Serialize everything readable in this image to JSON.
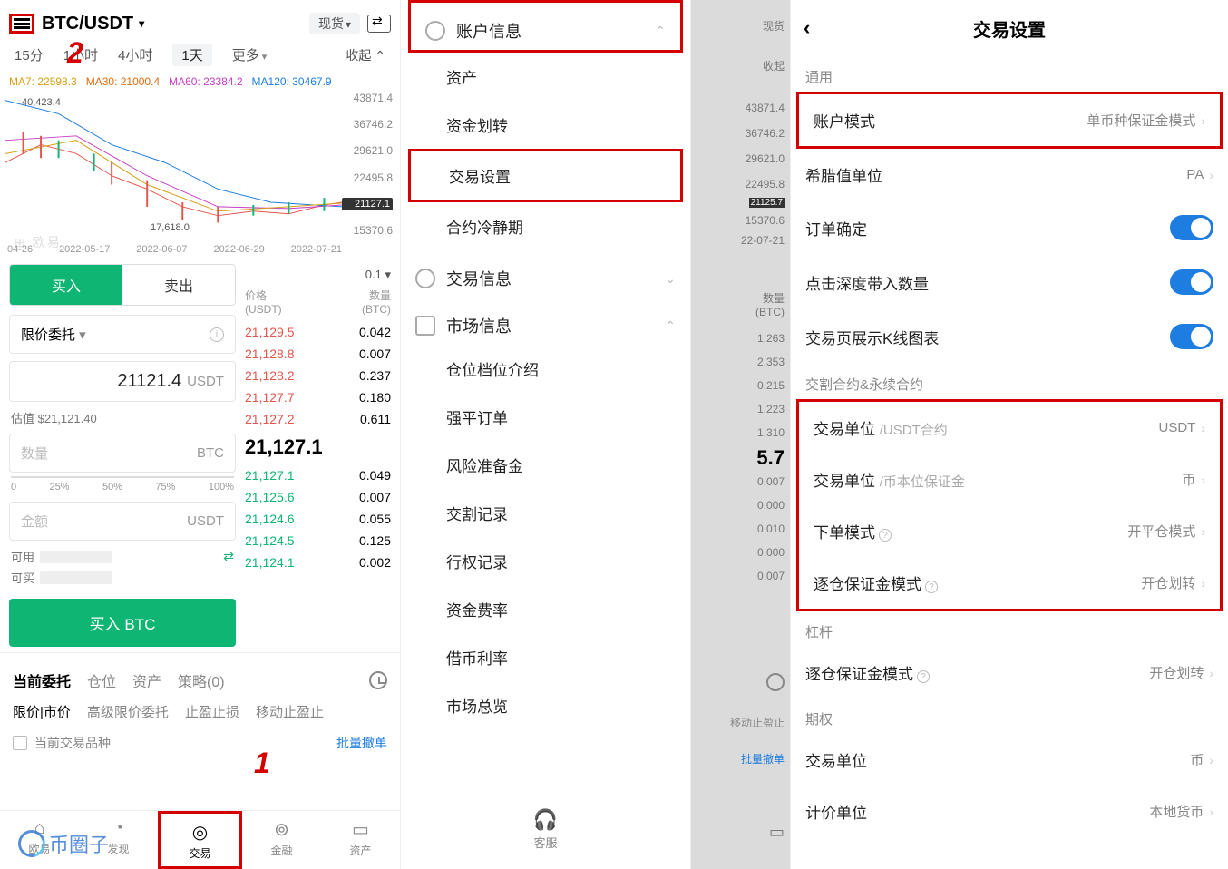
{
  "panel1": {
    "pair": "BTC/USDT",
    "spot": "现货",
    "timeframes": {
      "t15": "15分",
      "t1h": "1小时",
      "t4h": "4小时",
      "t1d": "1天",
      "more": "更多",
      "collapse": "收起"
    },
    "ma": {
      "ma7": "MA7: 22598.3",
      "ma30": "MA30: 21000.4",
      "ma60": "MA60: 23384.2",
      "ma120": "MA120: 30467.9"
    },
    "yaxis": {
      "y0": "43871.4",
      "y1": "36746.2",
      "y2": "29621.0",
      "y3": "22495.8",
      "y4": "15370.6",
      "cur": "21127.1"
    },
    "anno_hi": "40,423.4",
    "anno_lo": "17,618.0",
    "watermark": "⊞ 欧易",
    "xaxis": {
      "x0": "04-26",
      "x1": "2022-05-17",
      "x2": "2022-06-07",
      "x3": "2022-06-29",
      "x4": "2022-07-21"
    },
    "buy": "买入",
    "sell": "卖出",
    "order_type": "限价委托",
    "price_val": "21121.4",
    "price_unit": "USDT",
    "estimate": "估值 $21,121.40",
    "qty_ph": "数量",
    "qty_unit": "BTC",
    "slider": {
      "s0": "0",
      "s25": "25%",
      "s50": "50%",
      "s75": "75%",
      "s100": "100%"
    },
    "amt_ph": "金额",
    "amt_unit": "USDT",
    "avail_label": "可用",
    "canbuy_label": "可买",
    "buy_btn": "买入 BTC",
    "depth_step": "0.1",
    "book_hdr": {
      "price": "价格",
      "price_u": "(USDT)",
      "amt": "数量",
      "amt_u": "(BTC)"
    },
    "asks": [
      {
        "p": "21,129.5",
        "q": "0.042"
      },
      {
        "p": "21,128.8",
        "q": "0.007"
      },
      {
        "p": "21,128.2",
        "q": "0.237"
      },
      {
        "p": "21,127.7",
        "q": "0.180"
      },
      {
        "p": "21,127.2",
        "q": "0.611"
      }
    ],
    "mid": "21,127.1",
    "bids": [
      {
        "p": "21,127.1",
        "q": "0.049"
      },
      {
        "p": "21,125.6",
        "q": "0.007"
      },
      {
        "p": "21,124.6",
        "q": "0.055"
      },
      {
        "p": "21,124.5",
        "q": "0.125"
      },
      {
        "p": "21,124.1",
        "q": "0.002"
      }
    ],
    "pos_tabs": {
      "orders": "当前委托",
      "positions": "仓位",
      "assets": "资产",
      "strategy": "策略(0)"
    },
    "ord_tabs": {
      "limit": "限价|市价",
      "adv": "高级限价委托",
      "stop": "止盈止损",
      "trail": "移动止盈止"
    },
    "cur_symbol": "当前交易品种",
    "bulk_cancel": "批量撤单",
    "tabs": {
      "home": "欧易",
      "disc": "发现",
      "trade": "交易",
      "fin": "金融",
      "asset": "资产"
    },
    "num1": "1",
    "num2": "2"
  },
  "panel2": {
    "acct_info": "账户信息",
    "assets": "资产",
    "transfer": "资金划转",
    "trade_settings": "交易设置",
    "cooling": "合约冷静期",
    "trade_info": "交易信息",
    "market_info": "市场信息",
    "tier": "仓位档位介绍",
    "liq": "强平订单",
    "risk": "风险准备金",
    "delivery": "交割记录",
    "exercise": "行权记录",
    "funding": "资金费率",
    "borrow": "借币利率",
    "overview": "市场总览",
    "cs": "客服"
  },
  "panel3": {
    "spot": "现货",
    "collapse": "收起",
    "y": {
      "y0": "43871.4",
      "y1": "36746.2",
      "y2": "29621.0",
      "y3": "22495.8",
      "y4": "15370.6",
      "cur": "21125.7"
    },
    "x4": "22-07-21",
    "hdr_amt": "数量",
    "hdr_amt_u": "(BTC)",
    "q0": "1.263",
    "q1": "2.353",
    "q2": "0.215",
    "q3": "1.223",
    "q4": "1.310",
    "mid": "5.7",
    "b0": "0.007",
    "b1": "0.000",
    "b2": "0.010",
    "b3": "0.000",
    "b4": "0.007",
    "trail": "移动止盈止",
    "bulk": "批量撤单"
  },
  "panel4": {
    "title": "交易设置",
    "g_general": "通用",
    "acct_mode": "账户模式",
    "acct_mode_v": "单币种保证金模式",
    "greek": "希腊值单位",
    "greek_v": "PA",
    "confirm": "订单确定",
    "depth_qty": "点击深度带入数量",
    "show_kline": "交易页展示K线图表",
    "g_futures": "交割合约&永续合约",
    "unit_usdt": "交易单位",
    "unit_usdt_sub": "/USDT合约",
    "unit_usdt_v": "USDT",
    "unit_coin": "交易单位",
    "unit_coin_sub": "/币本位保证金",
    "unit_coin_v": "币",
    "order_mode": "下单模式",
    "order_mode_v": "开平仓模式",
    "iso_mode": "逐仓保证金模式",
    "iso_mode_v": "开仓划转",
    "g_lever": "杠杆",
    "lever_iso": "逐仓保证金模式",
    "lever_iso_v": "开仓划转",
    "g_option": "期权",
    "opt_unit": "交易单位",
    "opt_unit_v": "币",
    "quote_unit": "计价单位",
    "quote_unit_v": "本地货币"
  },
  "watermark_logo": "币圈子"
}
